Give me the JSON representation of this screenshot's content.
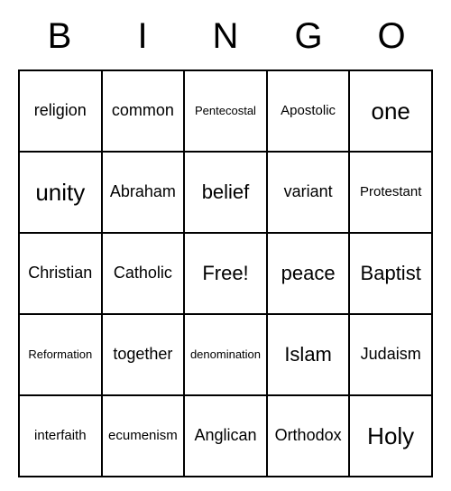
{
  "header": [
    "B",
    "I",
    "N",
    "G",
    "O"
  ],
  "cells": [
    {
      "text": "religion",
      "size": "m"
    },
    {
      "text": "common",
      "size": "m"
    },
    {
      "text": "Pentecostal",
      "size": "xs"
    },
    {
      "text": "Apostolic",
      "size": "s"
    },
    {
      "text": "one",
      "size": "xl"
    },
    {
      "text": "unity",
      "size": "xl"
    },
    {
      "text": "Abraham",
      "size": "m"
    },
    {
      "text": "belief",
      "size": "l"
    },
    {
      "text": "variant",
      "size": "m"
    },
    {
      "text": "Protestant",
      "size": "s"
    },
    {
      "text": "Christian",
      "size": "m"
    },
    {
      "text": "Catholic",
      "size": "m"
    },
    {
      "text": "Free!",
      "size": "l"
    },
    {
      "text": "peace",
      "size": "l"
    },
    {
      "text": "Baptist",
      "size": "l"
    },
    {
      "text": "Reformation",
      "size": "xs"
    },
    {
      "text": "together",
      "size": "m"
    },
    {
      "text": "denomination",
      "size": "xs"
    },
    {
      "text": "Islam",
      "size": "l"
    },
    {
      "text": "Judaism",
      "size": "m"
    },
    {
      "text": "interfaith",
      "size": "s"
    },
    {
      "text": "ecumenism",
      "size": "s"
    },
    {
      "text": "Anglican",
      "size": "m"
    },
    {
      "text": "Orthodox",
      "size": "m"
    },
    {
      "text": "Holy",
      "size": "xl"
    }
  ]
}
